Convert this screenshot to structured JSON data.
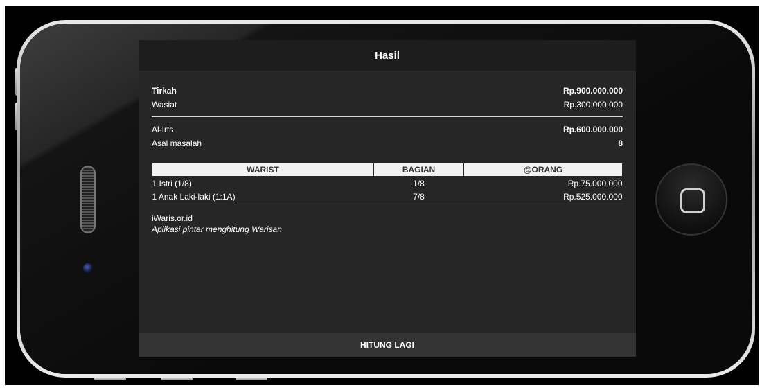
{
  "header": {
    "title": "Hasil"
  },
  "summary": {
    "tirkah_label": "Tirkah",
    "tirkah_value": "Rp.900.000.000",
    "wasiat_label": "Wasiat",
    "wasiat_value": "Rp.300.000.000",
    "alirts_label": "Al-Irts",
    "alirts_value": "Rp.600.000.000",
    "asal_label": "Asal masalah",
    "asal_value": "8"
  },
  "table": {
    "headers": [
      "WARIST",
      "BAGIAN",
      "@ORANG"
    ],
    "rows": [
      [
        "1 Istri (1/8)",
        "1/8",
        "Rp.75.000.000"
      ],
      [
        "1 Anak Laki-laki (1:1A)",
        "7/8",
        "Rp.525.000.000"
      ]
    ]
  },
  "footer": {
    "site": "iWaris.or.id",
    "tagline": "Aplikasi pintar menghitung Warisan"
  },
  "action": {
    "label": "HITUNG LAGI"
  }
}
